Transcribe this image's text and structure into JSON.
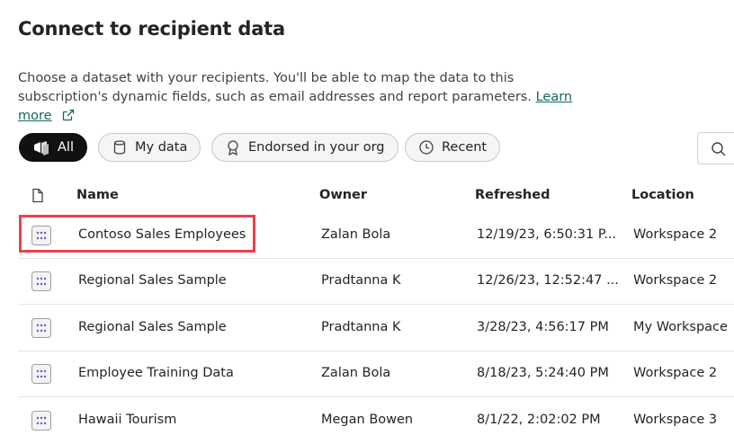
{
  "title": "Connect to recipient data",
  "description": {
    "text": "Choose a dataset with your recipients. You'll be able to map the data to this subscription's dynamic fields, such as email addresses and report parameters.",
    "link": "Learn more"
  },
  "filters": [
    {
      "label": "All",
      "icon": "all-items-icon",
      "active": true
    },
    {
      "label": "My data",
      "icon": "database-icon",
      "active": false
    },
    {
      "label": "Endorsed in your org",
      "icon": "endorsed-badge-icon",
      "active": false
    },
    {
      "label": "Recent",
      "icon": "clock-icon",
      "active": false
    }
  ],
  "search": {
    "icon": "search-icon"
  },
  "table": {
    "header_icon": "document-icon",
    "columns": [
      "Name",
      "Owner",
      "Refreshed",
      "Location"
    ],
    "rows": [
      {
        "name": "Contoso Sales Employees",
        "owner": "Zalan Bola",
        "refreshed": "12/19/23, 6:50:31 P...",
        "location": "Workspace 2",
        "highlighted": true
      },
      {
        "name": "Regional Sales Sample",
        "owner": "Pradtanna K",
        "refreshed": "12/26/23, 12:52:47 ...",
        "location": "Workspace 2"
      },
      {
        "name": "Regional Sales Sample",
        "owner": "Pradtanna K",
        "refreshed": "3/28/23, 4:56:17 PM",
        "location": "My Workspace"
      },
      {
        "name": "Employee Training Data",
        "owner": "Zalan Bola",
        "refreshed": "8/18/23, 5:24:40 PM",
        "location": "Workspace 2"
      },
      {
        "name": "Hawaii Tourism",
        "owner": "Megan Bowen",
        "refreshed": "8/1/22, 2:02:02 PM",
        "location": "Workspace 3"
      }
    ]
  },
  "colors": {
    "link": "#0f6a5c",
    "highlight": "#e8414d",
    "active_pill": "#111111"
  }
}
